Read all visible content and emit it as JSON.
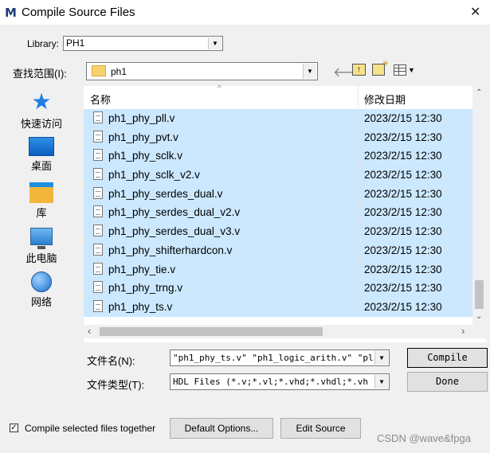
{
  "window": {
    "logo": "M",
    "title": "Compile Source Files",
    "close": "✕"
  },
  "library": {
    "label": "Library:",
    "value": "PH1"
  },
  "lookin": {
    "label": "查找范围(I):",
    "value": "ph1"
  },
  "places": [
    {
      "label": "快速访问",
      "icon": "quick-access-star-icon"
    },
    {
      "label": "桌面",
      "icon": "desktop-icon"
    },
    {
      "label": "库",
      "icon": "libraries-icon"
    },
    {
      "label": "此电脑",
      "icon": "this-pc-icon"
    },
    {
      "label": "网络",
      "icon": "network-icon"
    }
  ],
  "filelist": {
    "col_name": "名称",
    "col_date": "修改日期",
    "rows": [
      {
        "name": "ph1_phy_pll.v",
        "date": "2023/2/15 12:30"
      },
      {
        "name": "ph1_phy_pvt.v",
        "date": "2023/2/15 12:30"
      },
      {
        "name": "ph1_phy_sclk.v",
        "date": "2023/2/15 12:30"
      },
      {
        "name": "ph1_phy_sclk_v2.v",
        "date": "2023/2/15 12:30"
      },
      {
        "name": "ph1_phy_serdes_dual.v",
        "date": "2023/2/15 12:30"
      },
      {
        "name": "ph1_phy_serdes_dual_v2.v",
        "date": "2023/2/15 12:30"
      },
      {
        "name": "ph1_phy_serdes_dual_v3.v",
        "date": "2023/2/15 12:30"
      },
      {
        "name": "ph1_phy_shifterhardcon.v",
        "date": "2023/2/15 12:30"
      },
      {
        "name": "ph1_phy_tie.v",
        "date": "2023/2/15 12:30"
      },
      {
        "name": "ph1_phy_trng.v",
        "date": "2023/2/15 12:30"
      },
      {
        "name": "ph1_phy_ts.v",
        "date": "2023/2/15 12:30"
      }
    ]
  },
  "filename": {
    "label": "文件名(N):",
    "value": "\"ph1_phy_ts.v\" \"ph1_logic_arith.v\" \"pl"
  },
  "filetype": {
    "label": "文件类型(T):",
    "value": "HDL Files (*.v;*.vl;*.vhd;*.vhdl;*.vh"
  },
  "buttons": {
    "compile": "Compile",
    "done": "Done",
    "default_options": "Default Options...",
    "edit_source": "Edit Source"
  },
  "compile_together": {
    "label": "Compile selected files together",
    "checked": true
  },
  "watermark": "CSDN @wave&fpga"
}
